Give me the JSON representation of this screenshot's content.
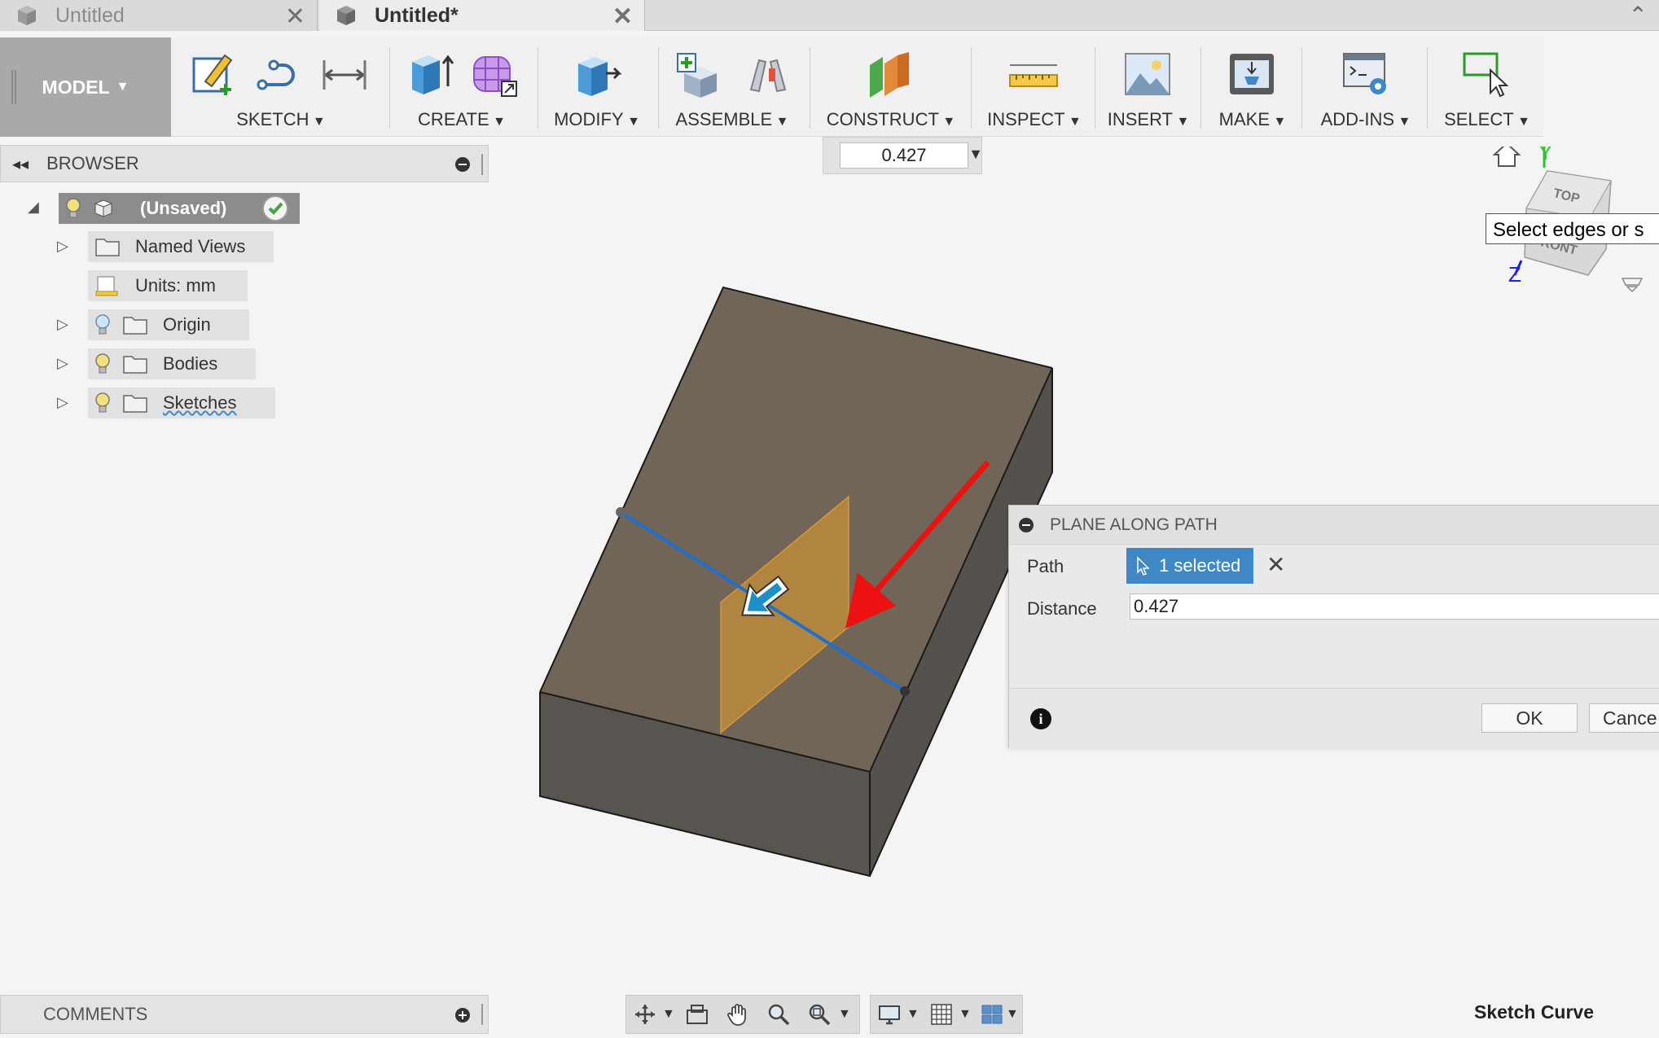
{
  "tabs": [
    {
      "label": "Untitled",
      "active": false
    },
    {
      "label": "Untitled*",
      "active": true
    }
  ],
  "toolbar": {
    "workspace": "MODEL",
    "groups": [
      "SKETCH",
      "CREATE",
      "MODIFY",
      "ASSEMBLE",
      "CONSTRUCT",
      "INSPECT",
      "INSERT",
      "MAKE",
      "ADD-INS",
      "SELECT"
    ]
  },
  "mini_input": {
    "value": "0.427"
  },
  "browser": {
    "title": "BROWSER",
    "root": "(Unsaved)",
    "nodes": [
      "Named Views",
      "Units: mm",
      "Origin",
      "Bodies",
      "Sketches"
    ]
  },
  "viewcube": {
    "top": "TOP",
    "front": "FRONT",
    "axis_y": "Y",
    "axis_z": "Z"
  },
  "tooltip": "Select edges or s",
  "dialog": {
    "title": "PLANE ALONG PATH",
    "path_label": "Path",
    "path_value": "1 selected",
    "distance_label": "Distance",
    "distance_value": "0.427",
    "ok": "OK",
    "cancel": "Cance"
  },
  "comments": {
    "title": "COMMENTS"
  },
  "status": "Sketch Curve",
  "colors": {
    "selection_blue": "#3f88c5",
    "body_top": "#706556",
    "plane_orange": "#e8a030",
    "arrow_red": "#ee1111",
    "axis_green": "#2ec42e",
    "axis_blue": "#2020e0"
  }
}
